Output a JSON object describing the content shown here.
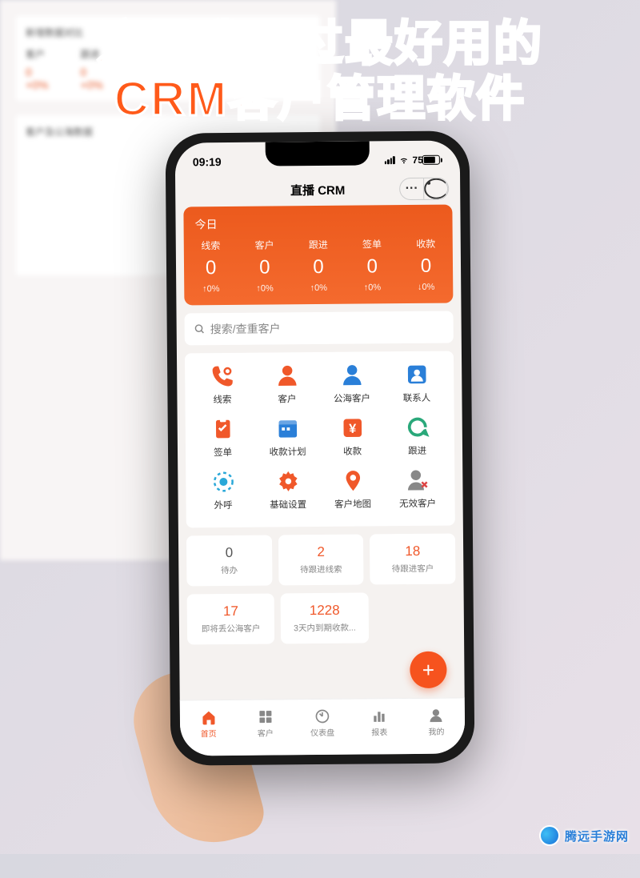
{
  "headline": {
    "line1": "这是我见过最好用的",
    "line2": "CRM客户管理软件"
  },
  "bg": {
    "section1_title": "新增数据对比",
    "lbl_customer": "客户",
    "lbl_followup": "跟进",
    "val": "0",
    "pct": "+0%",
    "section2_title": "客户及公海数据"
  },
  "status": {
    "time": "09:19",
    "battery": "75"
  },
  "app_title": "直播 CRM",
  "today_label": "今日",
  "stats": [
    {
      "label": "线索",
      "value": "0",
      "pct": "↑0%"
    },
    {
      "label": "客户",
      "value": "0",
      "pct": "↑0%"
    },
    {
      "label": "跟进",
      "value": "0",
      "pct": "↑0%"
    },
    {
      "label": "签单",
      "value": "0",
      "pct": "↑0%"
    },
    {
      "label": "收款",
      "value": "0",
      "pct": "↓0%"
    }
  ],
  "search_placeholder": "搜索/查重客户",
  "grid": [
    [
      {
        "label": "线索",
        "icon": "phone-lead",
        "color": "#f0582a"
      },
      {
        "label": "客户",
        "icon": "person",
        "color": "#f0582a"
      },
      {
        "label": "公海客户",
        "icon": "person",
        "color": "#2a7fd8"
      },
      {
        "label": "联系人",
        "icon": "contact",
        "color": "#2a7fd8"
      }
    ],
    [
      {
        "label": "签单",
        "icon": "clipboard",
        "color": "#f0582a"
      },
      {
        "label": "收款计划",
        "icon": "calendar",
        "color": "#2a7fd8"
      },
      {
        "label": "收款",
        "icon": "money",
        "color": "#f0582a"
      },
      {
        "label": "跟进",
        "icon": "refresh",
        "color": "#2aa87a"
      }
    ],
    [
      {
        "label": "外呼",
        "icon": "dial",
        "color": "#2aa8d8"
      },
      {
        "label": "基础设置",
        "icon": "gear",
        "color": "#f0582a"
      },
      {
        "label": "客户地图",
        "icon": "pin",
        "color": "#f0582a"
      },
      {
        "label": "无效客户",
        "icon": "person-x",
        "color": "#888"
      }
    ]
  ],
  "summary": [
    {
      "num": "0",
      "label": "待办",
      "cls": "num-gray"
    },
    {
      "num": "2",
      "label": "待跟进线索",
      "cls": "num-orange"
    },
    {
      "num": "18",
      "label": "待跟进客户",
      "cls": "num-orange"
    },
    {
      "num": "17",
      "label": "即将丢公海客户",
      "cls": "num-orange"
    },
    {
      "num": "1228",
      "label": "3天内到期收款...",
      "cls": "num-orange"
    }
  ],
  "tabs": [
    {
      "label": "首页",
      "active": true
    },
    {
      "label": "客户",
      "active": false
    },
    {
      "label": "仪表盘",
      "active": false
    },
    {
      "label": "报表",
      "active": false
    },
    {
      "label": "我的",
      "active": false
    }
  ],
  "watermark_text": "腾远手游网"
}
